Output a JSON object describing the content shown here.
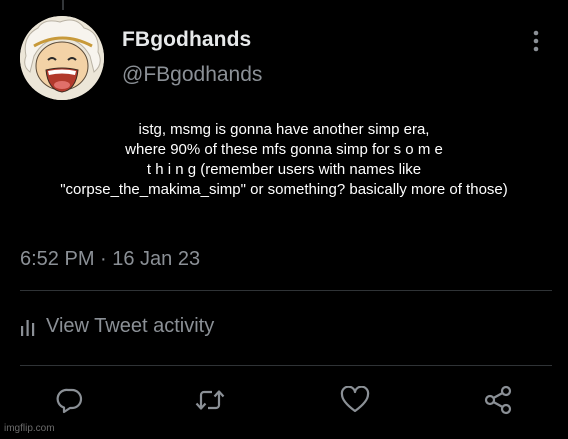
{
  "tweet": {
    "display_name": "FBgodhands",
    "handle": "@FBgodhands",
    "text": "istg, msmg is gonna have another simp era,\nwhere 90% of these mfs gonna simp for s o m e\nt h i n g (remember users with names like\n\"corpse_the_makima_simp\" or something? basically more of those)",
    "timestamp": "6:52 PM · 16 Jan 23",
    "activity_label": "View Tweet activity"
  },
  "icons": {
    "more": "more-vertical-icon",
    "activity": "bar-chart-icon",
    "reply": "reply-icon",
    "retweet": "retweet-icon",
    "like": "heart-icon",
    "share": "share-icon"
  },
  "colors": {
    "background": "#000000",
    "primary_text": "#e7e9ea",
    "secondary_text": "#8b9096",
    "divider": "#2f3336"
  },
  "watermark": "imgflip.com"
}
